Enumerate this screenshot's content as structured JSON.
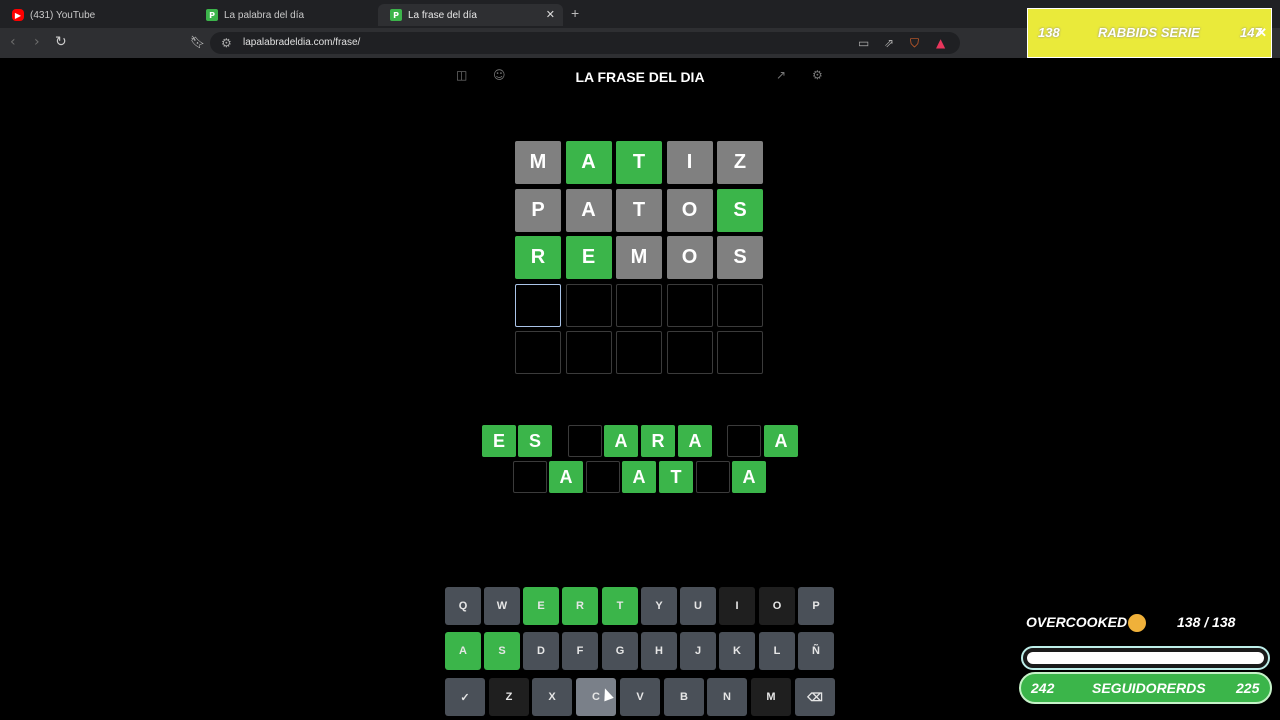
{
  "tabs": [
    {
      "label": "(431) YouTube",
      "icon": "youtube-icon"
    },
    {
      "label": "La palabra del día",
      "icon": "p-favicon-icon"
    },
    {
      "label": "La frase del día",
      "icon": "p-favicon-icon",
      "active": true
    }
  ],
  "address_bar": {
    "url": "lapalabradeldia.com/frase/"
  },
  "game": {
    "title": "LA FRASE DEL DIA"
  },
  "grid": [
    [
      {
        "l": "M",
        "s": "gray"
      },
      {
        "l": "A",
        "s": "green"
      },
      {
        "l": "T",
        "s": "green"
      },
      {
        "l": "I",
        "s": "gray"
      },
      {
        "l": "Z",
        "s": "gray"
      }
    ],
    [
      {
        "l": "P",
        "s": "gray"
      },
      {
        "l": "A",
        "s": "gray"
      },
      {
        "l": "T",
        "s": "gray"
      },
      {
        "l": "O",
        "s": "gray"
      },
      {
        "l": "S",
        "s": "green"
      }
    ],
    [
      {
        "l": "R",
        "s": "green"
      },
      {
        "l": "E",
        "s": "green"
      },
      {
        "l": "M",
        "s": "gray"
      },
      {
        "l": "O",
        "s": "gray"
      },
      {
        "l": "S",
        "s": "gray"
      }
    ],
    [
      {
        "l": "",
        "s": "active"
      },
      {
        "l": "",
        "s": "empty"
      },
      {
        "l": "",
        "s": "empty"
      },
      {
        "l": "",
        "s": "empty"
      },
      {
        "l": "",
        "s": "empty"
      }
    ],
    [
      {
        "l": "",
        "s": "empty"
      },
      {
        "l": "",
        "s": "empty"
      },
      {
        "l": "",
        "s": "empty"
      },
      {
        "l": "",
        "s": "empty"
      },
      {
        "l": "",
        "s": "empty"
      }
    ]
  ],
  "phrase": {
    "line1": [
      "E",
      "S",
      null,
      "",
      "A",
      "R",
      "A",
      null,
      "",
      "A"
    ],
    "line2": [
      "",
      "A",
      "",
      "A",
      "T",
      "",
      "A"
    ]
  },
  "keyboard": {
    "row1": [
      {
        "k": "Q",
        "s": "normal"
      },
      {
        "k": "W",
        "s": "normal"
      },
      {
        "k": "E",
        "s": "green"
      },
      {
        "k": "R",
        "s": "green"
      },
      {
        "k": "T",
        "s": "green"
      },
      {
        "k": "Y",
        "s": "normal"
      },
      {
        "k": "U",
        "s": "normal"
      },
      {
        "k": "I",
        "s": "dark"
      },
      {
        "k": "O",
        "s": "dark"
      },
      {
        "k": "P",
        "s": "normal"
      }
    ],
    "row2": [
      {
        "k": "A",
        "s": "green"
      },
      {
        "k": "S",
        "s": "green"
      },
      {
        "k": "D",
        "s": "normal"
      },
      {
        "k": "F",
        "s": "normal"
      },
      {
        "k": "G",
        "s": "normal"
      },
      {
        "k": "H",
        "s": "normal"
      },
      {
        "k": "J",
        "s": "normal"
      },
      {
        "k": "K",
        "s": "normal"
      },
      {
        "k": "L",
        "s": "normal"
      },
      {
        "k": "Ñ",
        "s": "normal"
      }
    ],
    "row3": [
      {
        "k": "✓",
        "s": "normal"
      },
      {
        "k": "Z",
        "s": "dark"
      },
      {
        "k": "X",
        "s": "normal"
      },
      {
        "k": "C",
        "s": "hover"
      },
      {
        "k": "V",
        "s": "normal"
      },
      {
        "k": "B",
        "s": "normal"
      },
      {
        "k": "N",
        "s": "normal"
      },
      {
        "k": "M",
        "s": "dark"
      },
      {
        "k": "⌫",
        "s": "normal"
      }
    ]
  },
  "overlay_top": {
    "left": "138",
    "title": "RABBIDS SERIE",
    "right": "147"
  },
  "overlay_bottom": {
    "title": "OVERCOOKED",
    "count": "138  / 138",
    "progress": 1.0,
    "left": "242",
    "label": "SEGUIDORERDS",
    "right": "225"
  }
}
